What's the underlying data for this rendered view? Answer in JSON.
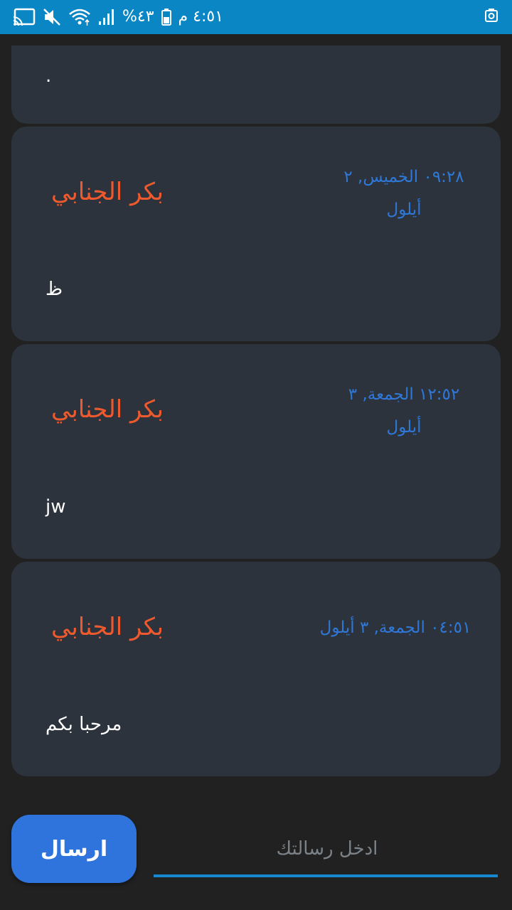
{
  "status_bar": {
    "time": "٤:٥١ م",
    "battery_percent": "٤٣%",
    "icons": [
      "battery-icon",
      "signal-icon",
      "wifi-icon",
      "mute-icon",
      "cast-icon",
      "screenshot-icon"
    ]
  },
  "messages": [
    {
      "text": "."
    },
    {
      "sender": "بكر الجنابي",
      "time_line1": "٠٩:٢٨ الخميس, ٢",
      "time_line2": "أيلول",
      "text": "ظ"
    },
    {
      "sender": "بكر الجنابي",
      "time_line1": "١٢:٥٢ الجمعة, ٣",
      "time_line2": "أيلول",
      "text": "jw"
    },
    {
      "sender": "بكر الجنابي",
      "time_line1": "٠٤:٥١ الجمعة, ٣ أيلول",
      "text": "مرحبا بكم"
    }
  ],
  "composer": {
    "placeholder": "ادخل رسالتك",
    "send_label": "ارسال"
  },
  "colors": {
    "status_bar": "#0a86c4",
    "background": "#212121",
    "card": "#2c333c",
    "sender": "#ee5a2e",
    "timestamp": "#2f78d8",
    "send_button": "#2f74dd",
    "input_underline": "#1788d0"
  }
}
